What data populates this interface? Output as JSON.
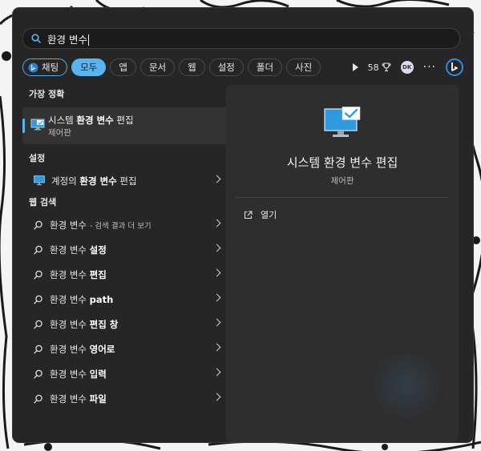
{
  "search": {
    "query": "환경 변수"
  },
  "chips": [
    {
      "label": "채팅"
    },
    {
      "label": "모두"
    },
    {
      "label": "앱"
    },
    {
      "label": "문서"
    },
    {
      "label": "웹"
    },
    {
      "label": "설정"
    },
    {
      "label": "폴더"
    },
    {
      "label": "사진"
    }
  ],
  "toolbar": {
    "points": "58",
    "avatar_initials": "DK"
  },
  "best_match": {
    "heading": "가장 정확",
    "title_pre": "시스템 ",
    "title_bold": "환경 변수",
    "title_post": " 편집",
    "subtitle": "제어판"
  },
  "settings": {
    "heading": "설정",
    "item": {
      "pre": "계정의 ",
      "bold": "환경 변수",
      "post": " 편집"
    }
  },
  "web": {
    "heading": "웹 검색",
    "items": [
      {
        "pre": "환경 변수",
        "bold": "",
        "suffix": "- 검색 결과 더 보기"
      },
      {
        "pre": "환경 변수 ",
        "bold": "설정",
        "suffix": ""
      },
      {
        "pre": "환경 변수 ",
        "bold": "편집",
        "suffix": ""
      },
      {
        "pre": "환경 변수 ",
        "bold": "path",
        "suffix": ""
      },
      {
        "pre": "환경 변수 ",
        "bold": "편집 창",
        "suffix": ""
      },
      {
        "pre": "환경 변수 ",
        "bold": "영어로",
        "suffix": ""
      },
      {
        "pre": "환경 변수 ",
        "bold": "입력",
        "suffix": ""
      },
      {
        "pre": "환경 변수 ",
        "bold": "파일",
        "suffix": ""
      }
    ]
  },
  "detail": {
    "title": "시스템 환경 변수 편집",
    "subtitle": "제어판",
    "open_label": "열기"
  },
  "colors": {
    "accent": "#59b4f0",
    "panel": "#262626",
    "detail_panel": "#2e2e2e"
  }
}
